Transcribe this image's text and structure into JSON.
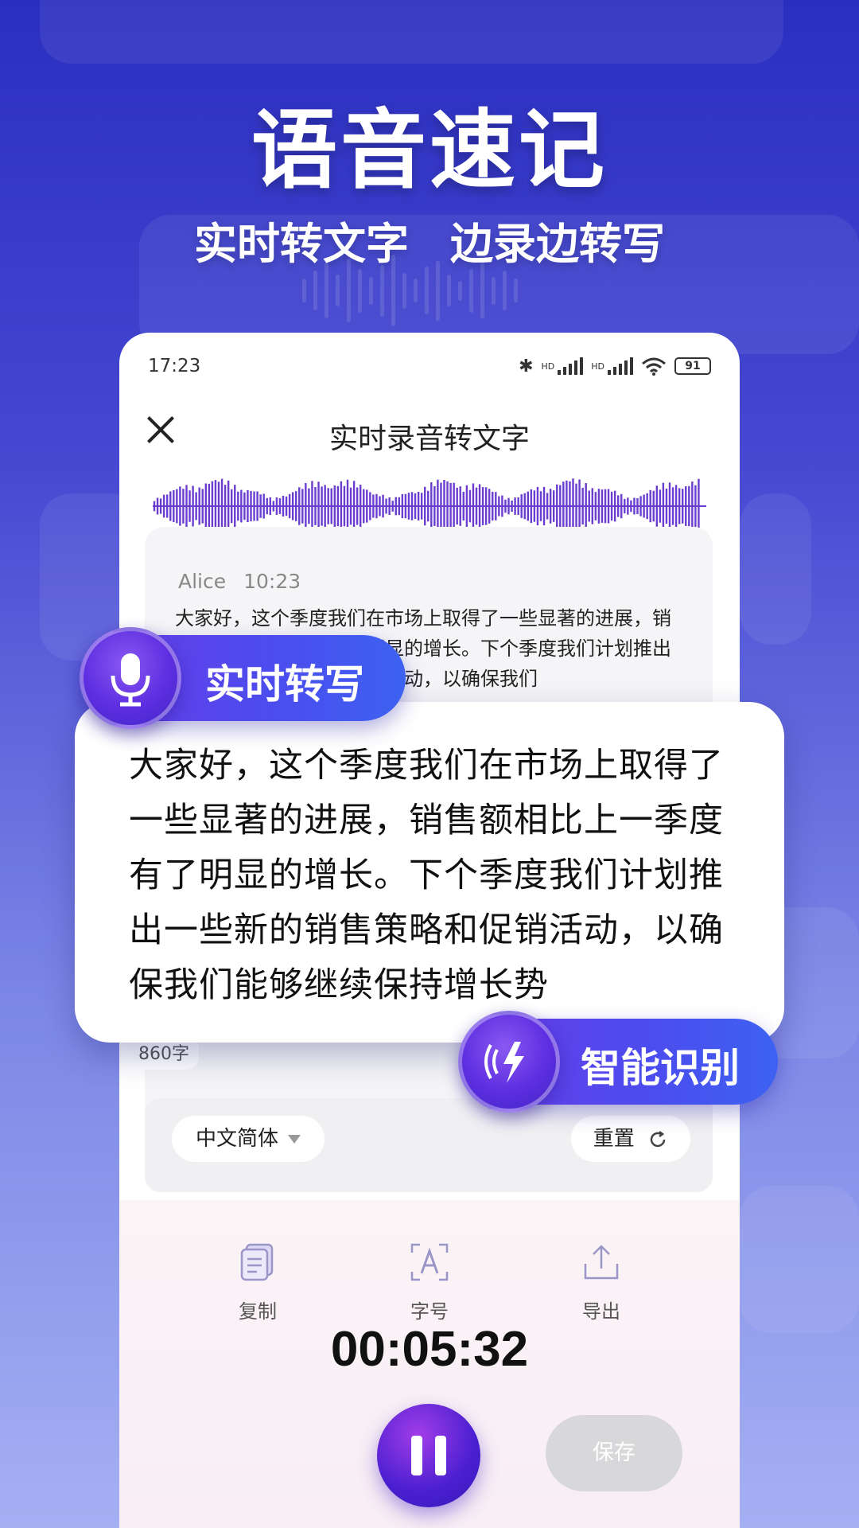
{
  "hero": {
    "title": "语音速记",
    "subtitle_left": "实时转文字",
    "subtitle_right": "边录边转写"
  },
  "status_bar": {
    "time": "17:23",
    "hd1": "HD",
    "hd2": "HD",
    "battery": "91"
  },
  "topbar": {
    "title": "实时录音转文字"
  },
  "transcript": {
    "speaker": "Alice",
    "time": "10:23",
    "text": "大家好，这个季度我们在市场上取得了一些显著的进展，销售额相比上一季度有了明显的增长。下个季度我们计划推出一些新的销售策略和促销活动，以确保我们",
    "char_count": "860字"
  },
  "controls": {
    "language": "中文简体",
    "reset_label": "重置"
  },
  "toolbar": {
    "copy_label": "复制",
    "font_label": "字号",
    "export_label": "导出"
  },
  "recording": {
    "timer": "00:05:32",
    "save_label": "保存"
  },
  "badges": {
    "realtime_label": "实时转写",
    "smart_label": "智能识别"
  },
  "highlight": {
    "text": "大家好，这个季度我们在市场上取得了一些显著的进展，销售额相比上一季度有了明显的增长。下个季度我们计划推出一些新的销售策略和促销活动，以确保我们能够继续保持增长势"
  },
  "colors": {
    "accent": "#5b3ae6",
    "waveform": "#6a3cd0"
  }
}
